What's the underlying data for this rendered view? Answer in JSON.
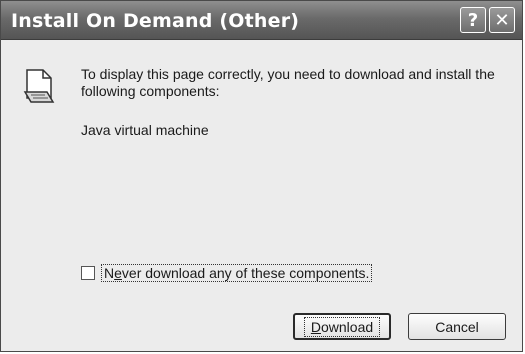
{
  "window": {
    "title": "Install On Demand (Other)",
    "help_icon": "?",
    "close_icon": "✕"
  },
  "message": "To display this page correctly, you need to download and install the following components:",
  "components": [
    "Java virtual machine"
  ],
  "never_download": {
    "checked": false,
    "pre": "N",
    "accel": "e",
    "post": "ver download any of these components."
  },
  "buttons": {
    "download": {
      "accel": "D",
      "rest": "ownload"
    },
    "cancel": "Cancel"
  }
}
